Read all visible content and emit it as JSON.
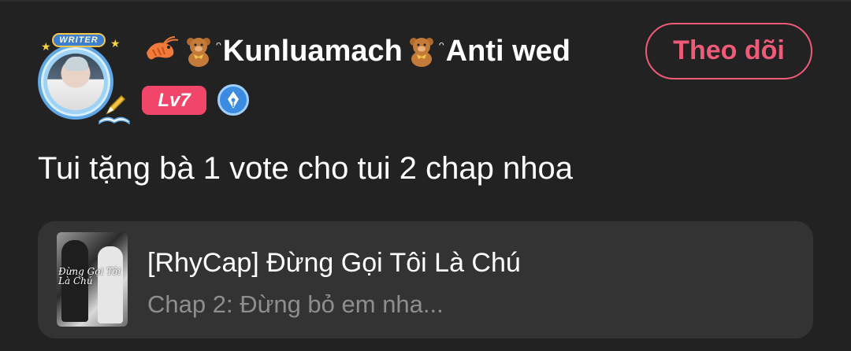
{
  "post": {
    "author": {
      "name_part1": "Kunluamach",
      "name_part2": "Anti wed",
      "avatar_badge": "WRITER",
      "level": "Lv7",
      "decorations": [
        "shrimp-icon",
        "teddy-bear-icon",
        "teddy-bear-icon"
      ]
    },
    "follow_label": "Theo dõi",
    "message": "Tui tặng bà 1 vote cho tui 2 chap nhoa",
    "story": {
      "title": "[RhyCap] Đừng Gọi Tôi Là Chú",
      "chapter": "Chap 2: Đừng bỏ em nha...",
      "cover_text": "Đừng Gọi Tôi Là Chú"
    }
  },
  "colors": {
    "background": "#222222",
    "card": "#333333",
    "accent": "#ef5a78",
    "level_badge": "#f1456a",
    "muted_text": "#8e8e8e"
  }
}
